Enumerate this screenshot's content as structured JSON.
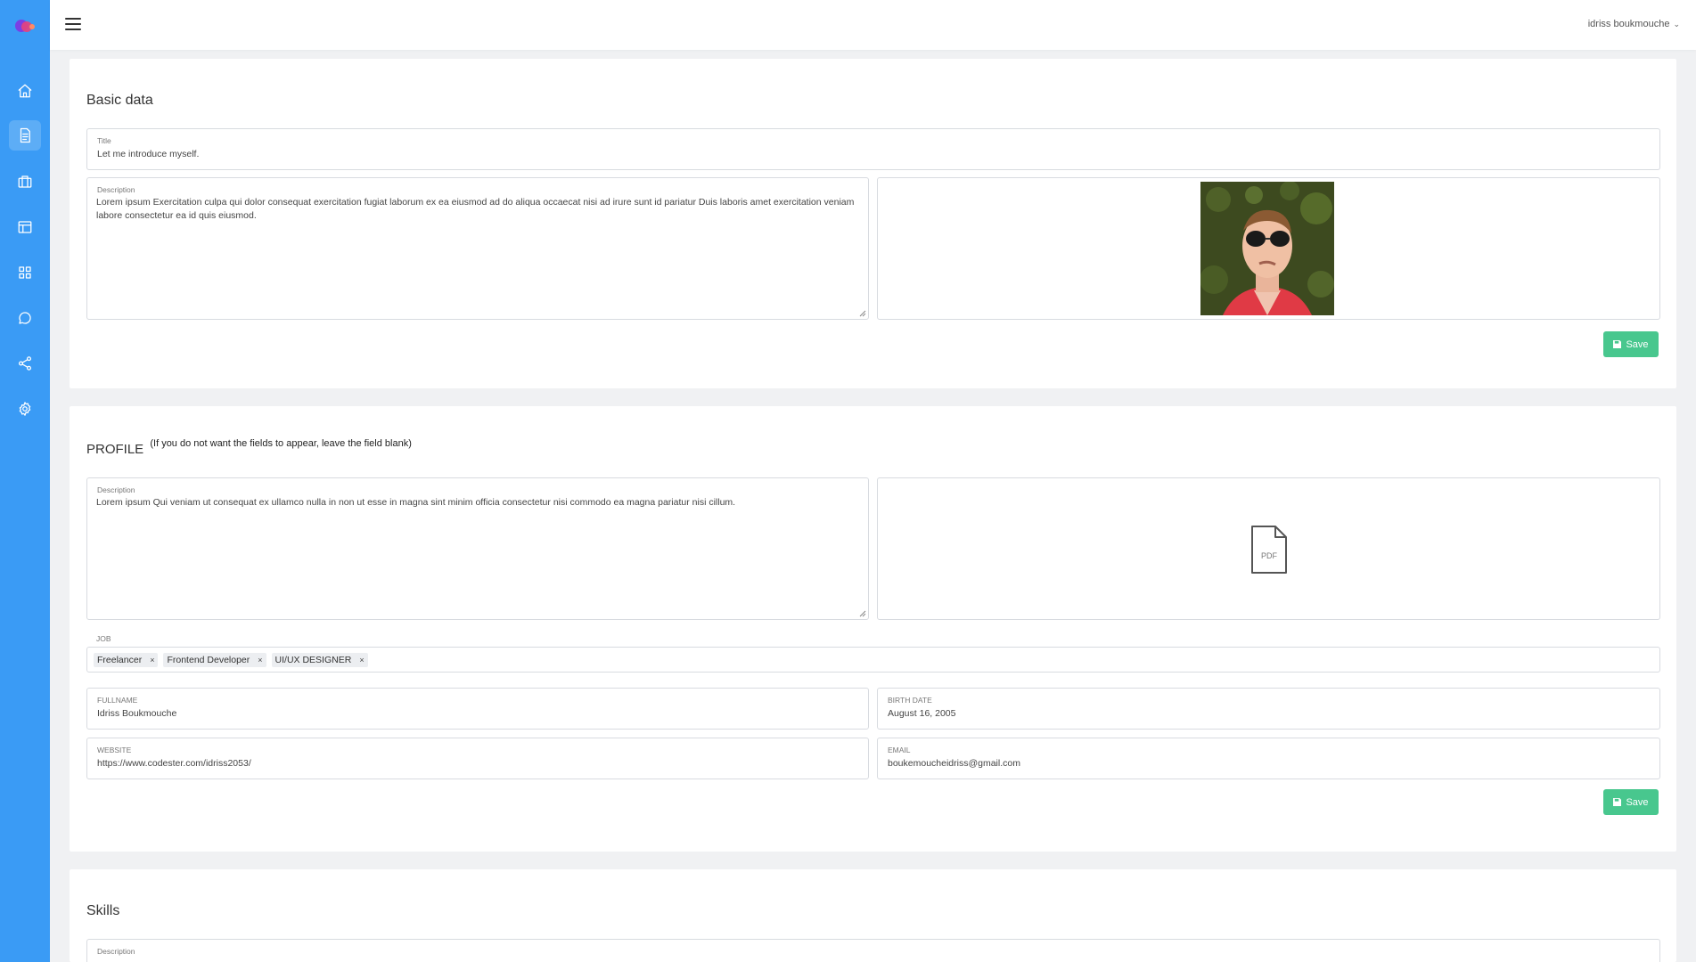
{
  "header": {
    "user_name": "idriss boukmouche",
    "chevron": "chevron-down"
  },
  "sidebar": {
    "items": [
      {
        "icon": "home-icon"
      },
      {
        "icon": "document-icon",
        "active": true
      },
      {
        "icon": "briefcase-icon"
      },
      {
        "icon": "layout-icon"
      },
      {
        "icon": "grid-icon"
      },
      {
        "icon": "chat-icon"
      },
      {
        "icon": "share-icon"
      },
      {
        "icon": "settings-icon"
      }
    ]
  },
  "basic": {
    "heading": "Basic data",
    "title_label": "Title",
    "title_value": "Let me introduce myself.",
    "desc_label": "Description",
    "desc_value": "Lorem ipsum Exercitation culpa qui dolor consequat exercitation fugiat laborum ex ea eiusmod ad do aliqua occaecat nisi ad irure sunt id pariatur Duis laboris amet exercitation veniam labore consectetur ea id quis eiusmod.",
    "save_label": "Save"
  },
  "profile": {
    "heading": "PROFILE",
    "note": "(If you do not want the fields to appear, leave the field blank)",
    "desc_label": "Description",
    "desc_value": "Lorem ipsum Qui veniam ut consequat ex ullamco nulla in non ut esse in magna sint minim officia consectetur nisi commodo ea magna pariatur nisi cillum.",
    "pdf_text": "PDF",
    "job_label": "JOB",
    "jobs": [
      "Freelancer",
      "Frontend Developer",
      "UI/UX DESIGNER"
    ],
    "tag_remove": "×",
    "fullname_label": "FULLNAME",
    "fullname_value": "Idriss Boukmouche",
    "birth_label": "BIRTH DATE",
    "birth_value": "August 16, 2005",
    "website_label": "WEBSITE",
    "website_value": "https://www.codester.com/idriss2053/",
    "email_label": "EMAIL",
    "email_value": "boukemoucheidriss@gmail.com",
    "save_label": "Save"
  },
  "skills": {
    "heading": "Skills",
    "desc_label": "Description"
  },
  "colors": {
    "sidebar": "#3a9bf5",
    "save": "#48c78e",
    "background": "#f0f1f3"
  }
}
